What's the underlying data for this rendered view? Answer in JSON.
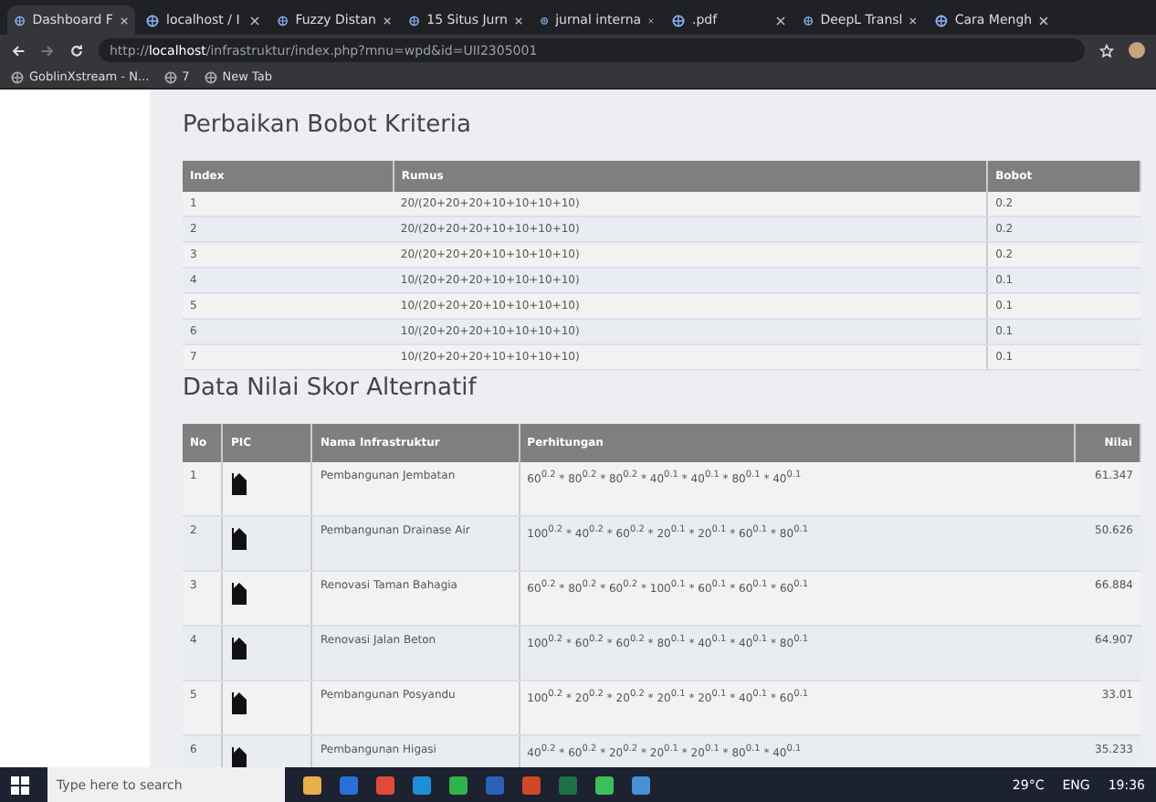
{
  "browser": {
    "tabs": [
      {
        "label": "Dashboard F",
        "selected": true
      },
      {
        "label": "localhost / I",
        "selected": false
      },
      {
        "label": "Fuzzy Distan",
        "selected": false
      },
      {
        "label": "15 Situs Jurn",
        "selected": false
      },
      {
        "label": "jurnal interna",
        "selected": false
      },
      {
        "label": ".pdf",
        "selected": false
      },
      {
        "label": "DeepL Transl",
        "selected": false
      },
      {
        "label": "Cara Mengh",
        "selected": false
      }
    ],
    "url_prefix": "http://",
    "url_host": "localhost",
    "url_path": "/infrastruktur/index.php?mnu=wpd&id=UII2305001",
    "bookmarks": [
      "GoblinXstream - N...",
      "7",
      "New Tab"
    ]
  },
  "criteria": {
    "title": "Perbaikan Bobot Kriteria",
    "columns": [
      "Index",
      "Rumus",
      "Bobot"
    ],
    "rows": [
      [
        "1",
        "20/(20+20+20+10+10+10+10)",
        "0.2"
      ],
      [
        "2",
        "20/(20+20+20+10+10+10+10)",
        "0.2"
      ],
      [
        "3",
        "20/(20+20+20+10+10+10+10)",
        "0.2"
      ],
      [
        "4",
        "10/(20+20+20+10+10+10+10)",
        "0.1"
      ],
      [
        "5",
        "10/(20+20+20+10+10+10+10)",
        "0.1"
      ],
      [
        "6",
        "10/(20+20+20+10+10+10+10)",
        "0.1"
      ],
      [
        "7",
        "10/(20+20+20+10+10+10+10)",
        "0.1"
      ]
    ]
  },
  "scores": {
    "title": "Data Nilai Skor Alternatif",
    "columns": [
      "No",
      "PIC",
      "Nama Infrastruktur",
      "Perhitungan",
      "Nilai"
    ],
    "rows": [
      {
        "no": "1",
        "name": "Pembangunan Jembatan",
        "calc": "60$^{0.2}$ * 80$^{0.2}$ * 80$^{0.2}$ * 40$^{0.1}$ * 40$^{0.1}$ * 80$^{0.1}$ * 40$^{0.1}$",
        "value": "61.347"
      },
      {
        "no": "2",
        "name": "Pembangunan Drainase Air",
        "calc": "100$^{0.2}$ * 40$^{0.2}$ * 60$^{0.2}$ * 20$^{0.1}$ * 20$^{0.1}$ * 60$^{0.1}$ * 80$^{0.1}$",
        "value": "50.626"
      },
      {
        "no": "3",
        "name": "Renovasi Taman Bahagia",
        "calc": "60$^{0.2}$ * 80$^{0.2}$ * 60$^{0.2}$ * 100$^{0.1}$ * 60$^{0.1}$ * 60$^{0.1}$ * 60$^{0.1}$",
        "value": "66.884"
      },
      {
        "no": "4",
        "name": "Renovasi Jalan Beton",
        "calc": "100$^{0.2}$ * 60$^{0.2}$ * 60$^{0.2}$ * 80$^{0.1}$ * 40$^{0.1}$ * 40$^{0.1}$ * 80$^{0.1}$",
        "value": "64.907"
      },
      {
        "no": "5",
        "name": "Pembangunan Posyandu",
        "calc": "100$^{0.2}$ * 20$^{0.2}$ * 20$^{0.2}$ * 20$^{0.1}$ * 20$^{0.1}$ * 40$^{0.1}$ * 60$^{0.1}$",
        "value": "33.01"
      },
      {
        "no": "6",
        "name": "Pembangunan Higasi",
        "calc": "40$^{0.2}$ * 60$^{0.2}$ * 20$^{0.2}$ * 20$^{0.1}$ * 20$^{0.1}$ * 80$^{0.1}$ * 40$^{0.1}$",
        "value": "35.233"
      }
    ]
  },
  "taskbar": {
    "search_placeholder": "Type here to search",
    "temperature": "29°C",
    "language": "ENG",
    "time": "19:36"
  }
}
